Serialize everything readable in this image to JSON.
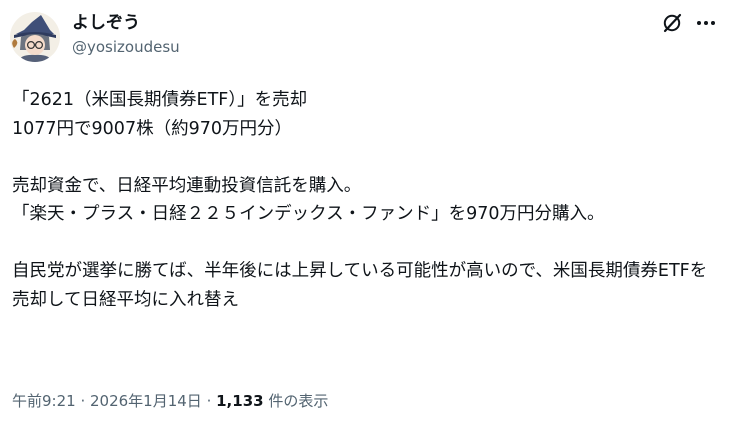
{
  "user": {
    "display_name": "よしぞう",
    "handle": "@yosizoudesu",
    "avatar_icon": "wizard-avatar"
  },
  "header_icons": {
    "grok": "grok-slash-icon",
    "more": "more-dots-icon"
  },
  "post": {
    "lines": [
      "「2621（米国長期債券ETF）」を売却",
      "1077円で9007株（約970万円分）",
      "",
      "売却資金で、日経平均連動投資信託を購入。",
      "「楽天・プラス・日経２２５インデックス・ファンド」を970万円分購入。",
      "",
      "自民党が選挙に勝てば、半年後には上昇している可能性が高いので、米国長期債券ETFを売却して日経平均に入れ替え"
    ]
  },
  "meta": {
    "time": "午前9:21",
    "sep1": " · ",
    "date": "2026年1月14日",
    "sep2": " · ",
    "views_count": "1,133",
    "views_label": " 件の表示"
  },
  "colors": {
    "text": "#0f1419",
    "secondary": "#536471"
  }
}
